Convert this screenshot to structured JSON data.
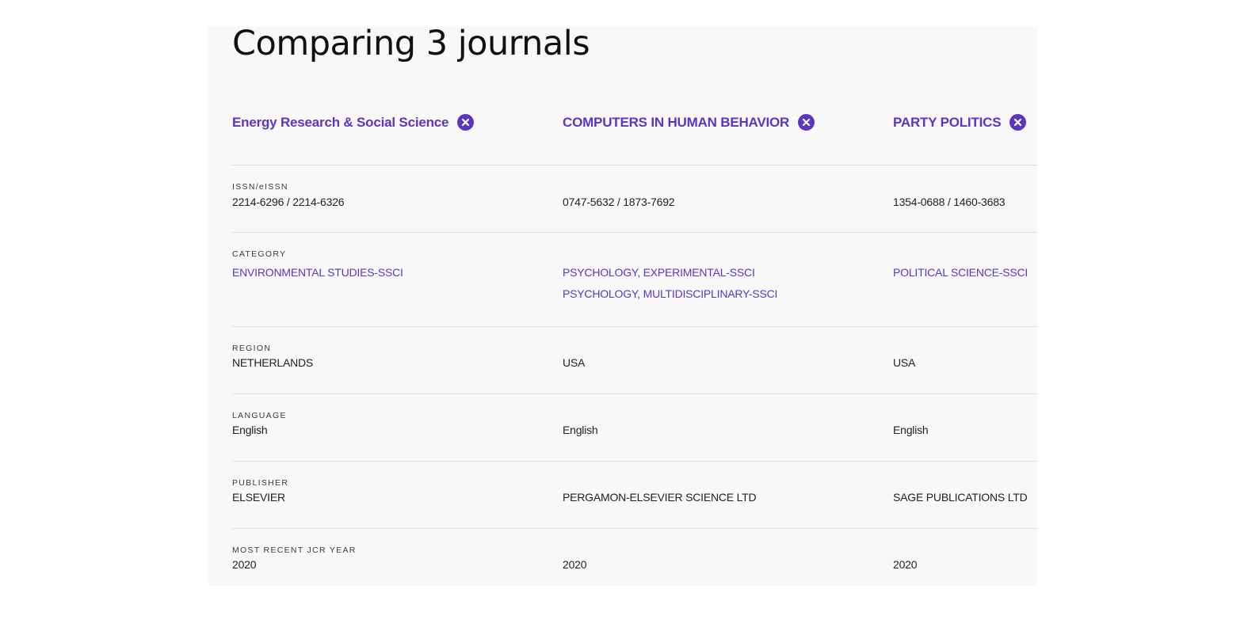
{
  "title": "Comparing 3 journals",
  "accent_color": "#5b35c4",
  "journals": [
    {
      "name": "Energy Research & Social Science",
      "remove_icon": "close-circle-icon",
      "issn": "2214-6296 / 2214-6326",
      "categories": [
        "ENVIRONMENTAL STUDIES-SSCI"
      ],
      "region": "NETHERLANDS",
      "language": "English",
      "publisher": "ELSEVIER",
      "jcr_year": "2020"
    },
    {
      "name": "COMPUTERS IN HUMAN BEHAVIOR",
      "remove_icon": "close-circle-icon",
      "issn": "0747-5632 / 1873-7692",
      "categories": [
        "PSYCHOLOGY, EXPERIMENTAL-SSCI",
        "PSYCHOLOGY, MULTIDISCIPLINARY-SSCI"
      ],
      "region": "USA",
      "language": "English",
      "publisher": "PERGAMON-ELSEVIER SCIENCE LTD",
      "jcr_year": "2020"
    },
    {
      "name": "PARTY POLITICS",
      "remove_icon": "close-circle-icon",
      "issn": "1354-0688 / 1460-3683",
      "categories": [
        "POLITICAL SCIENCE-SSCI"
      ],
      "region": "USA",
      "language": "English",
      "publisher": "SAGE PUBLICATIONS LTD",
      "jcr_year": "2020"
    }
  ],
  "labels": {
    "issn": "ISSN/eISSN",
    "category": "CATEGORY",
    "region": "REGION",
    "language": "LANGUAGE",
    "publisher": "PUBLISHER",
    "jcr_year": "MOST RECENT JCR YEAR"
  }
}
